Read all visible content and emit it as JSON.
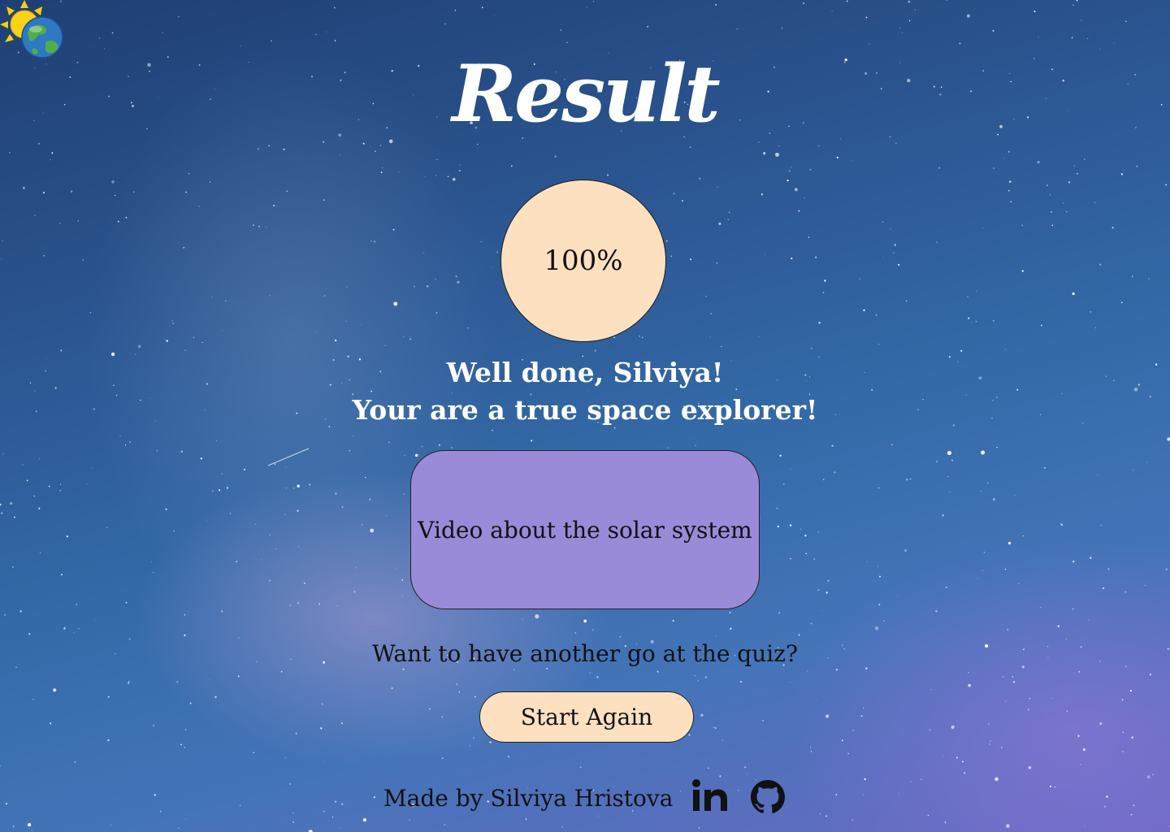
{
  "title": "Result",
  "score": "100%",
  "message": {
    "line1": "Well done, Silviya!",
    "line2": "Your are a true space explorer!"
  },
  "video_button_label": "Video about the solar system",
  "prompt": "Want to have another go at the quiz?",
  "start_again_label": "Start Again",
  "footer": {
    "made_by": "Made by Silviya Hristova",
    "social_icons": [
      "linkedin-icon",
      "github-icon"
    ]
  },
  "colors": {
    "circle_fill": "#fde0c0",
    "video_button_fill": "#9b8ad8",
    "start_button_fill": "#fde0c0",
    "text_light": "#ffffff",
    "text_dark": "#111111"
  }
}
